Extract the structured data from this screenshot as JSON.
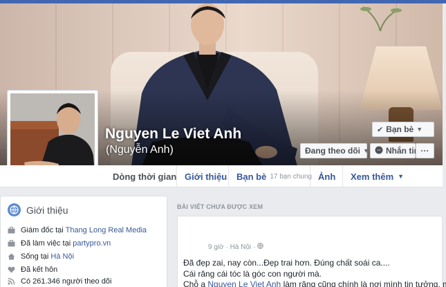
{
  "profile": {
    "name": "Nguyen Le Viet Anh",
    "alternate_name": "(Nguyễn Anh)"
  },
  "actions": {
    "friends_label": "Bạn bè",
    "following_label": "Đang theo dõi",
    "message_label": "Nhắn tin",
    "more_label": "···"
  },
  "tabs": [
    {
      "label": "Dòng thời gian",
      "active": true
    },
    {
      "label": "Giới thiệu"
    },
    {
      "label": "Bạn bè",
      "sub": "17 bạn chung"
    },
    {
      "label": "Ảnh"
    },
    {
      "label": "Xem thêm"
    }
  ],
  "intro": {
    "title": "Giới thiệu",
    "rows": [
      {
        "icon": "briefcase-icon",
        "prefix": "Giám đốc tại ",
        "link": "Thang Long Real Media"
      },
      {
        "icon": "briefcase-icon",
        "prefix": "Đã làm việc tại ",
        "link": "partypro.vn"
      },
      {
        "icon": "home-icon",
        "prefix": "Sống tại ",
        "link": "Hà Nội"
      },
      {
        "icon": "heart-icon",
        "prefix": "Đã kết hôn",
        "link": ""
      },
      {
        "icon": "rss-icon",
        "prefix": "Có 261.346 người theo dõi",
        "link": ""
      }
    ]
  },
  "feed": {
    "section_label": "BÀI VIẾT CHƯA ĐƯỢC XEM",
    "post": {
      "time": "9 giờ",
      "location": "Hà Nội",
      "privacy_icon": "globe-icon",
      "lines": [
        "Đã đẹp zai, nay còn...Đẹp trai hơn. Đúng chất soái ca....",
        "Cái răng cái tóc là góc con người mà.",
        "Chỗ a "
      ],
      "mention": "Nguyen Le Viet Anh",
      "line3_suffix": " làm răng cũng chính là nơi mình tin tưởng, mình"
    }
  },
  "colors": {
    "brand": "#4267b2",
    "link": "#365899",
    "text": "#1d2129"
  }
}
